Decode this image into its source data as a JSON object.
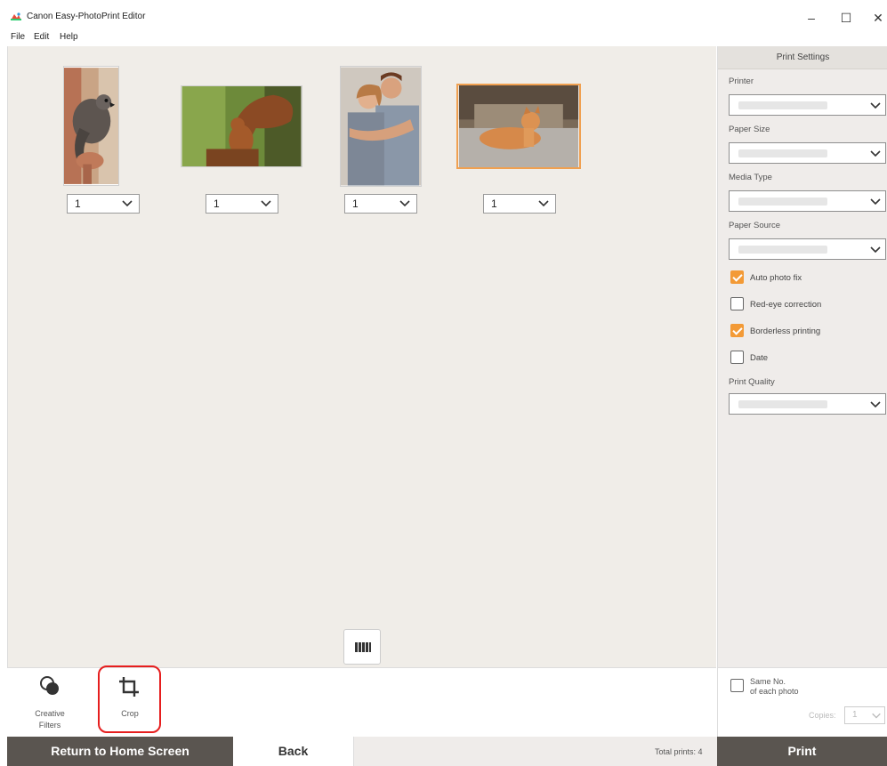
{
  "window": {
    "title": "Canon Easy-PhotoPrint Editor",
    "minimize": "–",
    "maximize": "☐",
    "close": "✕"
  },
  "menu": {
    "file": "File",
    "edit": "Edit",
    "help": "Help"
  },
  "photos": [
    {
      "name": "parrot",
      "qty": "1"
    },
    {
      "name": "squirrel",
      "qty": "1"
    },
    {
      "name": "couple",
      "qty": "1"
    },
    {
      "name": "cat",
      "qty": "1"
    }
  ],
  "panel": {
    "header": "Print Settings",
    "printer_label": "Printer",
    "paper_size_label": "Paper Size",
    "media_type_label": "Media Type",
    "paper_source_label": "Paper Source",
    "print_quality_label": "Print Quality",
    "checkboxes": [
      {
        "label": "Auto photo fix",
        "checked": true
      },
      {
        "label": "Red-eye correction",
        "checked": false
      },
      {
        "label": "Borderless printing",
        "checked": true
      },
      {
        "label": "Date",
        "checked": false
      }
    ]
  },
  "tools": {
    "creative_filters_line1": "Creative",
    "creative_filters_line2": "Filters",
    "crop": "Crop"
  },
  "sameno": {
    "line1": "Same No.",
    "line2": "of each photo",
    "copies_label": "Copies:",
    "copies_value": "1"
  },
  "bottom": {
    "home": "Return to Home Screen",
    "back": "Back",
    "total": "Total prints: 4",
    "print": "Print"
  },
  "colors": {
    "accent": "#f39a36",
    "dark_button": "#5a5550",
    "highlight": "#e61e1e"
  }
}
